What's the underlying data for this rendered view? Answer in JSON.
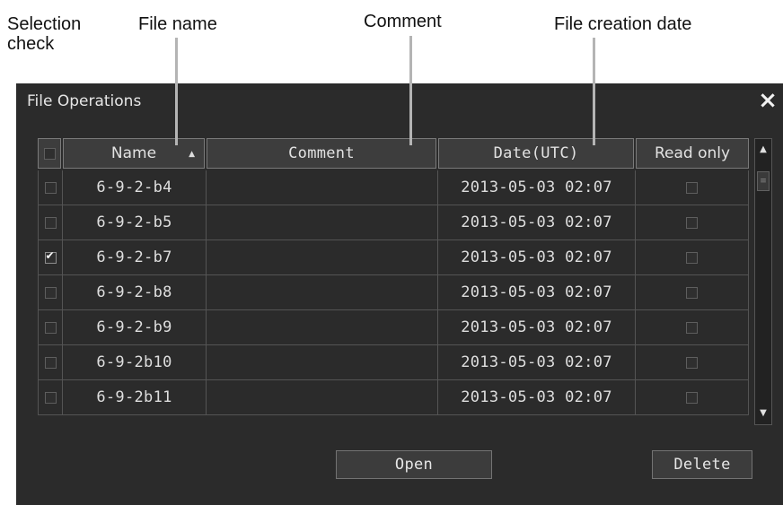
{
  "callouts": {
    "selection_check": "Selection\ncheck",
    "file_name": "File name",
    "comment": "Comment",
    "file_creation_date": "File creation date"
  },
  "dialog": {
    "title": "File Operations",
    "close_icon": "×"
  },
  "table": {
    "headers": {
      "name": "Name",
      "comment": "Comment",
      "date": "Date(UTC)",
      "read_only": "Read only"
    },
    "sort": "ascending",
    "rows": [
      {
        "selected": false,
        "name": "6-9-2-b4",
        "comment": "",
        "date": "2013-05-03 02:07",
        "read_only": false
      },
      {
        "selected": false,
        "name": "6-9-2-b5",
        "comment": "",
        "date": "2013-05-03 02:07",
        "read_only": false
      },
      {
        "selected": true,
        "name": "6-9-2-b7",
        "comment": "",
        "date": "2013-05-03 02:07",
        "read_only": false
      },
      {
        "selected": false,
        "name": "6-9-2-b8",
        "comment": "",
        "date": "2013-05-03 02:07",
        "read_only": false
      },
      {
        "selected": false,
        "name": "6-9-2-b9",
        "comment": "",
        "date": "2013-05-03 02:07",
        "read_only": false
      },
      {
        "selected": false,
        "name": "6-9-2b10",
        "comment": "",
        "date": "2013-05-03 02:07",
        "read_only": false
      },
      {
        "selected": false,
        "name": "6-9-2b11",
        "comment": "",
        "date": "2013-05-03 02:07",
        "read_only": false
      }
    ]
  },
  "buttons": {
    "open": "Open",
    "delete": "Delete"
  },
  "colors": {
    "dialog_bg": "#2b2b2b",
    "header_bg": "#3d3d3d",
    "text": "#e0e0e0"
  }
}
